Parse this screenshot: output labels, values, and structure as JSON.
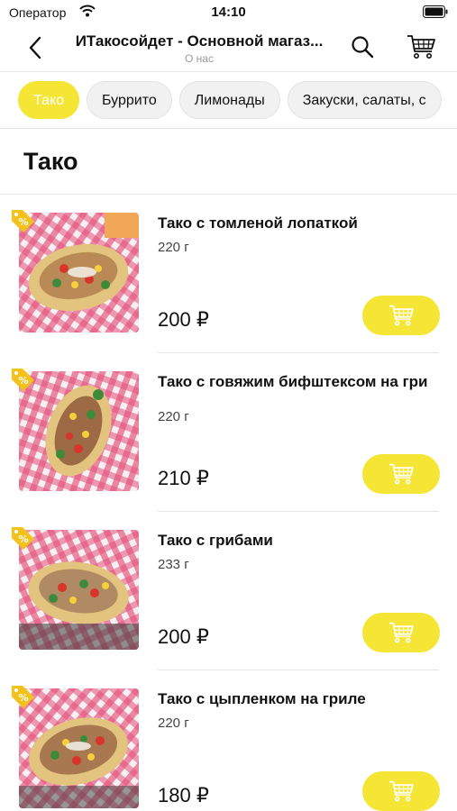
{
  "status_bar": {
    "carrier": "Оператор",
    "time": "14:10"
  },
  "nav": {
    "title": "ИТакосойдет - Основной магаз...",
    "subtitle": "О нас"
  },
  "categories": [
    {
      "label": "Тако",
      "active": true
    },
    {
      "label": "Буррито",
      "active": false
    },
    {
      "label": "Лимонады",
      "active": false
    },
    {
      "label": "Закуски, салаты, с",
      "active": false
    }
  ],
  "section": {
    "title": "Тако"
  },
  "products": [
    {
      "name": "Тако с томленой лопаткой",
      "weight": "220 г",
      "price": "200 ₽"
    },
    {
      "name": "Тако с говяжим бифштексом на гри",
      "weight": "220 г",
      "price": "210 ₽"
    },
    {
      "name": "Тако с грибами",
      "weight": "233 г",
      "price": "200 ₽"
    },
    {
      "name": "Тако с цыпленком на гриле",
      "weight": "220 г",
      "price": "180 ₽"
    }
  ],
  "colors": {
    "accent": "#f5e535",
    "badge": "#f2c21a"
  }
}
